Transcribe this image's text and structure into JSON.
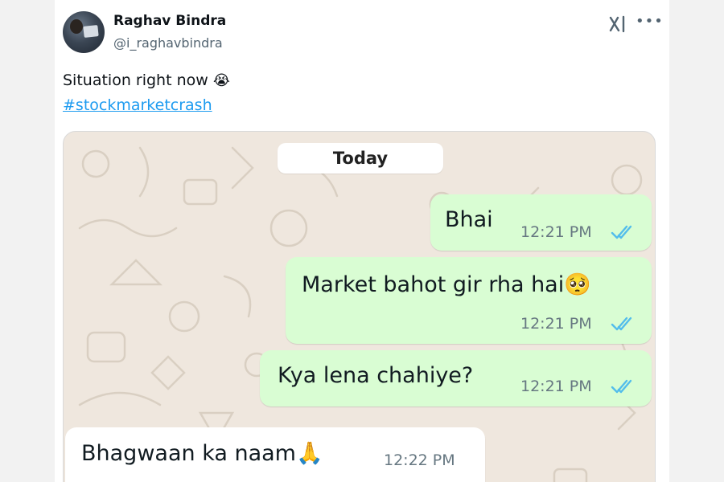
{
  "tweet": {
    "author_name": "Raghav Bindra",
    "author_handle": "@i_raghavbindra",
    "text": "Situation right now",
    "text_emoji": "😭",
    "hashtag": "#stockmarketcrash"
  },
  "chat": {
    "date_chip": "Today",
    "messages": [
      {
        "direction": "outgoing",
        "text": "Bhai",
        "time": "12:21 PM",
        "status": "read"
      },
      {
        "direction": "outgoing",
        "text": "Market bahot gir rha hai",
        "emoji": "🥺",
        "time": "12:21 PM",
        "status": "read"
      },
      {
        "direction": "outgoing",
        "text": "Kya lena chahiye?",
        "time": "12:21 PM",
        "status": "read"
      },
      {
        "direction": "incoming",
        "text": "Bhagwaan ka naam",
        "emoji": "🙏",
        "time": "12:22 PM"
      }
    ]
  },
  "colors": {
    "outgoing_bubble": "#d9fdd3",
    "incoming_bubble": "#ffffff",
    "chat_background": "#efe7de",
    "read_ticks": "#53bdeb",
    "hashtag": "#1d9bf0"
  },
  "icons": [
    "grok-icon",
    "more-icon"
  ]
}
